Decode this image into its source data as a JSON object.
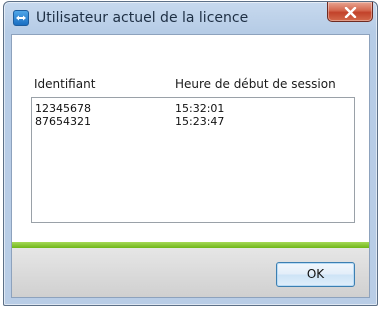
{
  "window": {
    "title": "Utilisateur actuel de la licence",
    "close_label": "X"
  },
  "table": {
    "columns": [
      "Identifiant",
      "Heure de début de session"
    ],
    "rows": [
      [
        "12345678",
        "15:32:01"
      ],
      [
        "87654321",
        "15:23:47"
      ]
    ]
  },
  "buttons": {
    "ok_label": "OK"
  },
  "colors": {
    "accent_green": "#7dc220",
    "close_red": "#c7442d"
  },
  "icons": {
    "app": "teamviewer-icon",
    "close": "close-icon"
  }
}
